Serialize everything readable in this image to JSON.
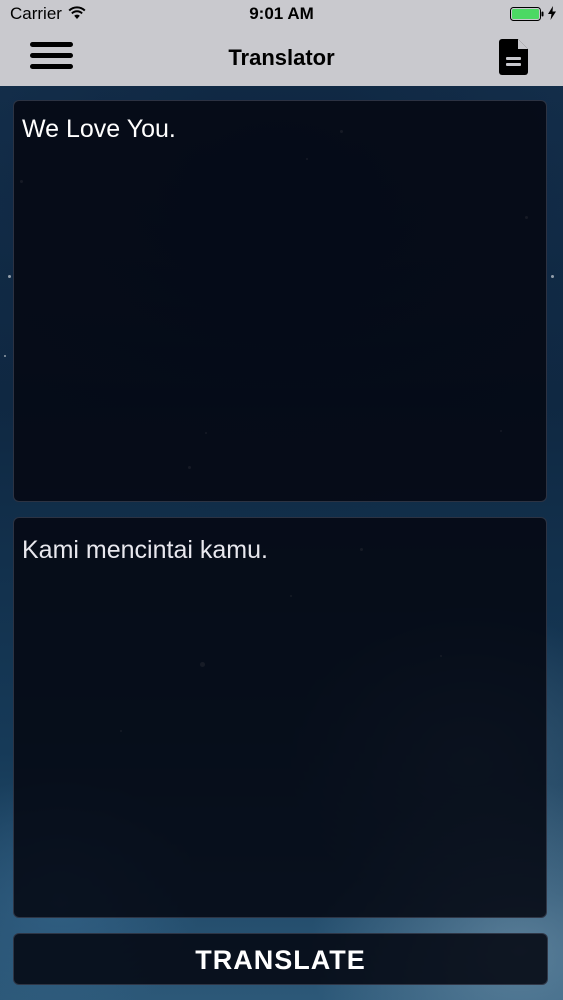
{
  "status_bar": {
    "carrier": "Carrier",
    "time": "9:01 AM",
    "battery_color": "#4cd964"
  },
  "nav_bar": {
    "title": "Translator",
    "menu_icon": "hamburger-menu-icon",
    "document_icon": "document-icon"
  },
  "source": {
    "text": "We Love You."
  },
  "target": {
    "text": "Kami mencintai kamu."
  },
  "actions": {
    "translate_label": "TRANSLATE"
  }
}
